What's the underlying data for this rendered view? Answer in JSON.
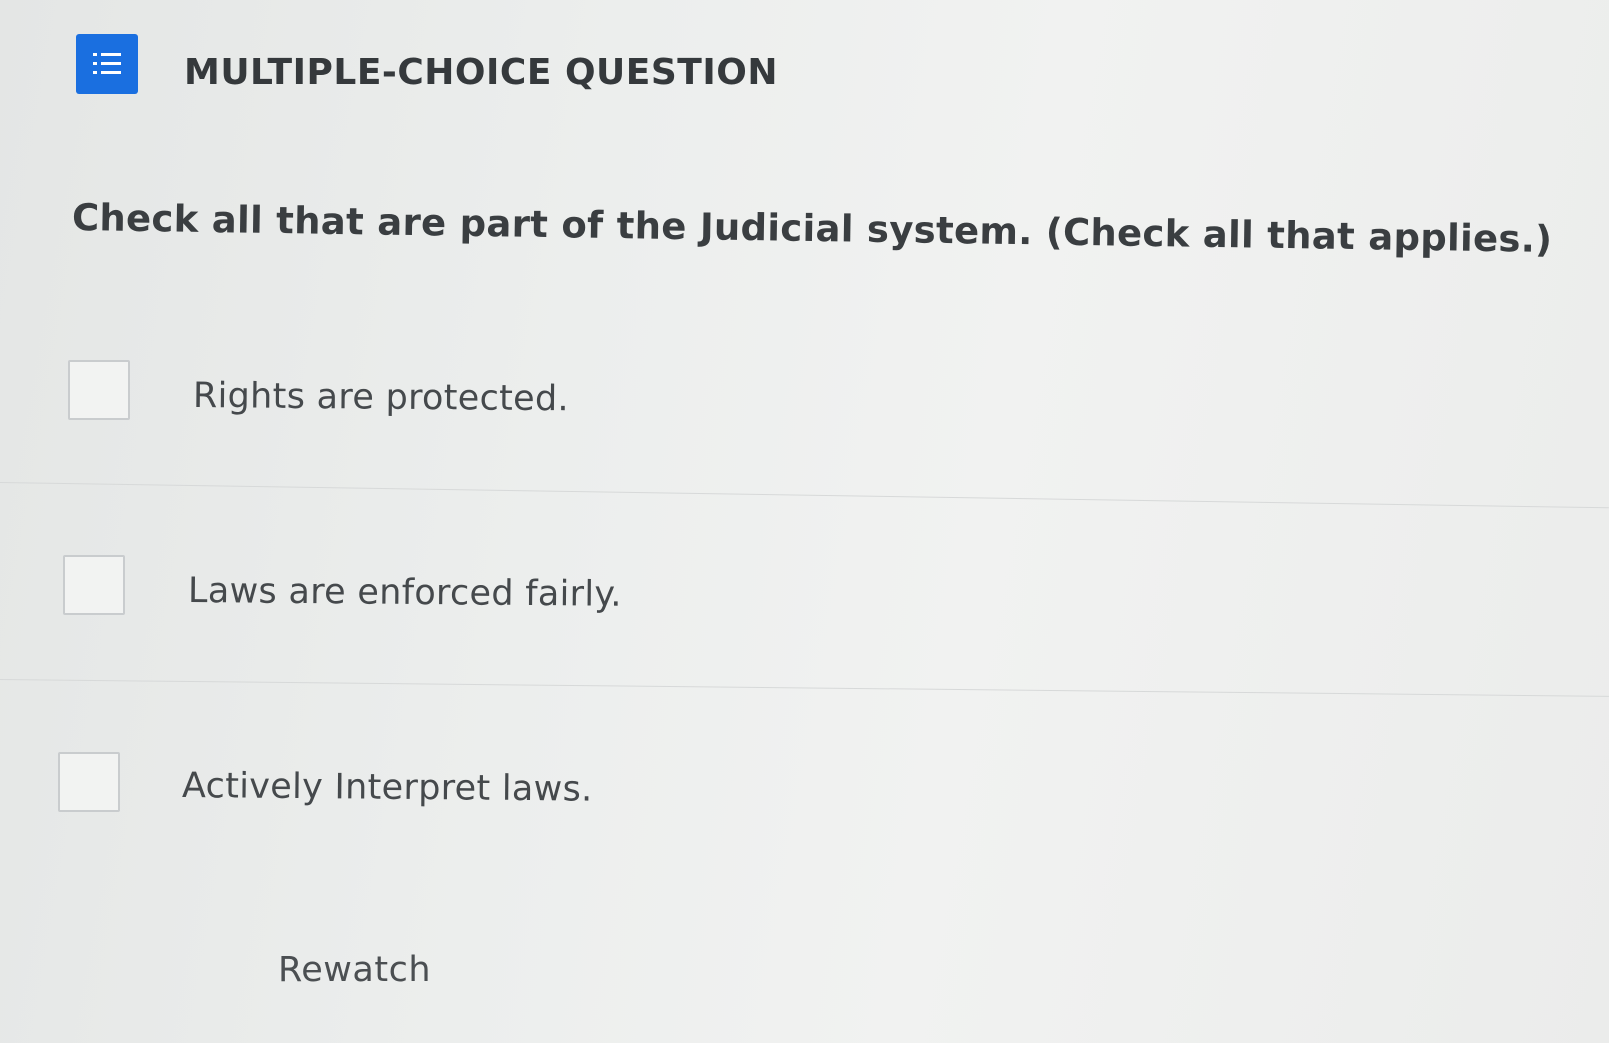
{
  "header": {
    "icon": "list-numbered-icon",
    "title": "MULTIPLE-CHOICE QUESTION",
    "icon_color": "#1a6fe0"
  },
  "question": {
    "text": "Check all that are part of the Judicial system. (Check all that applies.)"
  },
  "options": [
    {
      "label": "Rights are protected.",
      "checked": false
    },
    {
      "label": "Laws are enforced fairly.",
      "checked": false
    },
    {
      "label": "Actively Interpret laws.",
      "checked": false
    }
  ],
  "footer": {
    "rewatch_label": "Rewatch"
  }
}
